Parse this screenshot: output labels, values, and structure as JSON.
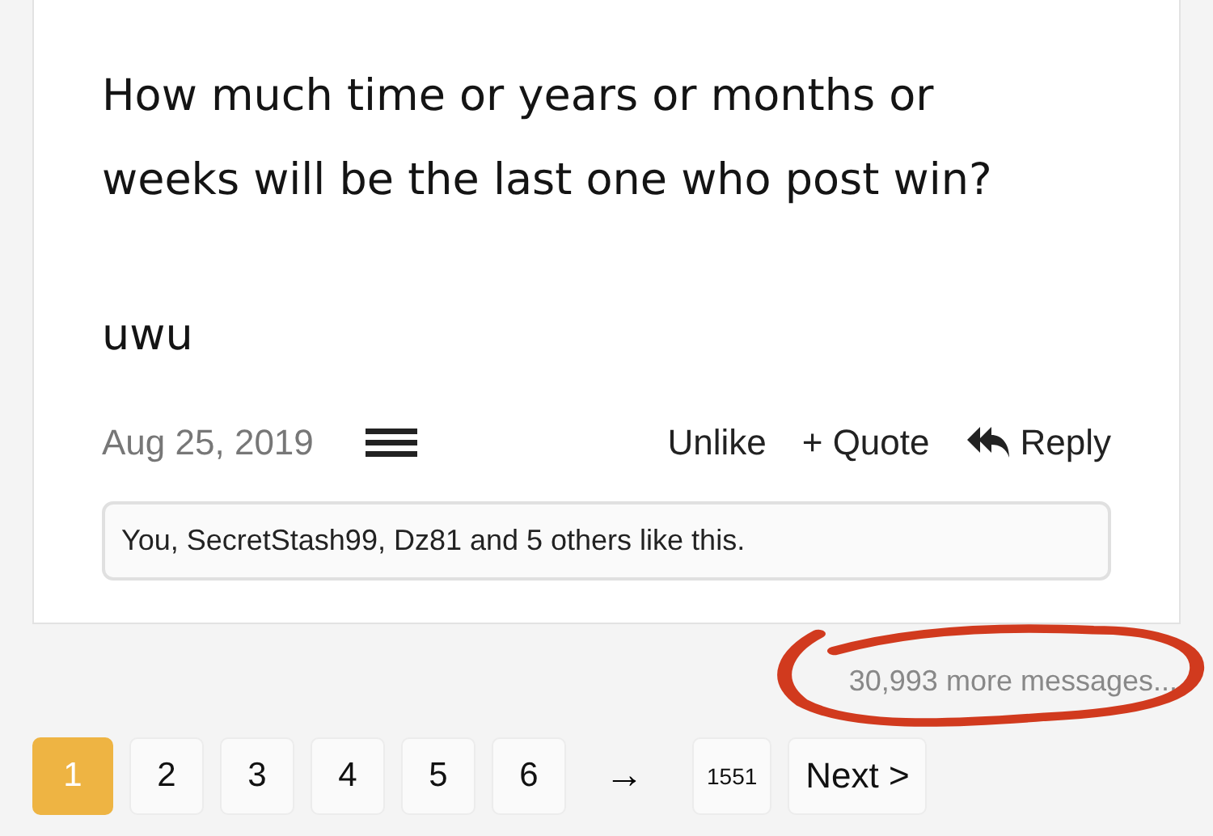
{
  "post": {
    "paragraphs": [
      "How much time or years or months or weeks will be the last one who post win?",
      "uwu"
    ],
    "date": "Aug 25, 2019",
    "actions": [
      {
        "kind": "plain",
        "label": "Unlike"
      },
      {
        "kind": "plain",
        "label": "+ Quote"
      },
      {
        "kind": "reply",
        "label": "Reply"
      }
    ],
    "likes": "You, SecretStash99, Dz81 and 5 others like this."
  },
  "more_messages": "30,993 more messages...",
  "pagination": [
    {
      "kind": "page",
      "label": "1",
      "selected": true
    },
    {
      "kind": "page",
      "label": "2",
      "selected": false
    },
    {
      "kind": "page",
      "label": "3",
      "selected": false
    },
    {
      "kind": "page",
      "label": "4",
      "selected": false
    },
    {
      "kind": "page",
      "label": "5",
      "selected": false
    },
    {
      "kind": "page",
      "label": "6",
      "selected": false
    },
    {
      "kind": "gap",
      "label": "→"
    },
    {
      "kind": "last",
      "label": "1551",
      "selected": false
    },
    {
      "kind": "next",
      "label": "Next >"
    }
  ]
}
